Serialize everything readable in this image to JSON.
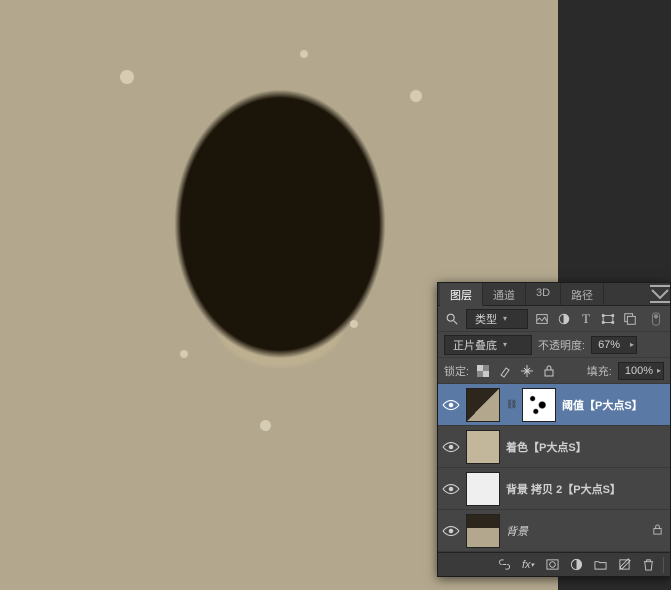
{
  "panel": {
    "tabs": {
      "layers": "图层",
      "channels": "通道",
      "three_d": "3D",
      "paths": "路径"
    },
    "filter": {
      "kind_icon": "search-icon",
      "kind_label": "类型",
      "icons": [
        "image-filter-icon",
        "adjustment-filter-icon",
        "text-filter-icon",
        "shape-filter-icon",
        "smart-filter-icon"
      ]
    },
    "blend": {
      "mode": "正片叠底",
      "opacity_label": "不透明度:",
      "opacity_value": "67%"
    },
    "lock": {
      "label": "锁定:",
      "fill_label": "填充:",
      "fill_value": "100%"
    },
    "layers": [
      {
        "id": "threshold",
        "name": "阈值【P大点S】",
        "has_mask": true,
        "thumb": "adj",
        "selected": true
      },
      {
        "id": "tint",
        "name": "着色【P大点S】",
        "thumb": "tan",
        "selected": false
      },
      {
        "id": "bgcopy",
        "name": "背景 拷贝 2【P大点S】",
        "thumb": "white",
        "selected": false
      },
      {
        "id": "background",
        "name": "背景",
        "thumb": "bg",
        "selected": false,
        "locked": true,
        "italic": true
      }
    ],
    "footer_icons": [
      "link-icon",
      "fx-icon",
      "mask-icon",
      "adjustment-icon",
      "group-icon",
      "new-layer-icon",
      "trash-icon"
    ]
  }
}
